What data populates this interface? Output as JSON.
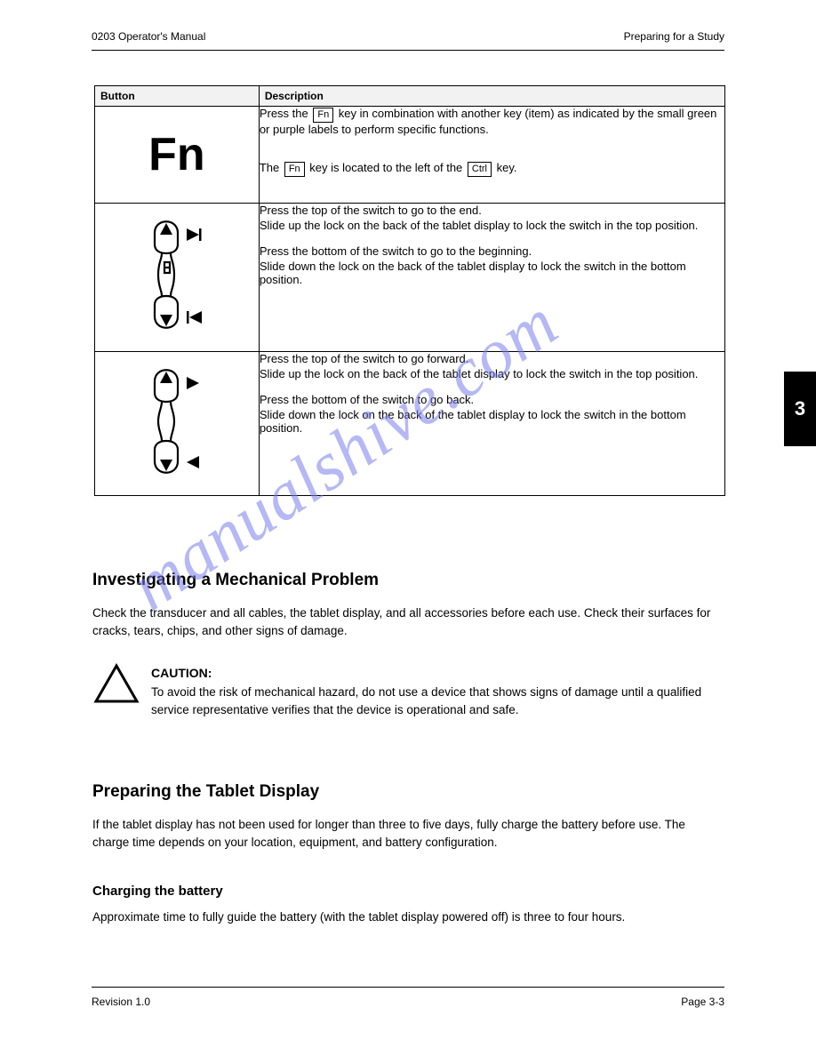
{
  "header": {
    "left": "0203 Operator's Manual",
    "right": "Preparing for a Study"
  },
  "table": {
    "th_button": "Button",
    "th_desc": "Description",
    "row1_text1": "Press the ",
    "row1_key1": "Fn",
    "row1_text2": " key in combination with another key (item) as indicated by the small green or purple labels to perform specific functions.",
    "row1_text3": "The ",
    "row1_key2": "Fn",
    "row1_text4": " key is located to the left of the ",
    "row1_key3": "Ctrl",
    "row1_text5": " key.",
    "row2_line1": "Press the top of the switch to go to the end.",
    "row2_line2": "Slide up the lock on the back of the tablet display to lock the switch in the top position.",
    "row2_line3": "Press the bottom of the switch to go to the beginning.",
    "row2_line4": "Slide down the lock on the back of the tablet display to lock the switch in the bottom position.",
    "row3_line1": "Press the top of the switch to go forward.",
    "row3_line2": "Slide up the lock on the back of the tablet display to lock the switch in the top position.",
    "row3_line3": "Press the bottom of the switch to go back.",
    "row3_line4": "Slide down the lock on the back of the tablet display to lock the switch in the bottom position."
  },
  "sidebar": {
    "number": "3"
  },
  "sections": {
    "heading1": "Investigating a Mechanical Problem",
    "p1": "Check the transducer and all cables, the tablet display, and all accessories before each use. Check their surfaces for cracks, tears, chips, and other signs of damage.",
    "caution_label": "CAUTION:",
    "caution_body": "To avoid the risk of mechanical hazard, do not use a device that shows signs of damage until a qualified service representative verifies that the device is operational and safe.",
    "heading2": "Preparing the Tablet Display",
    "p2": "If the tablet display has not been used for longer than three to five days, fully charge the battery before use. The charge time depends on your location, equipment, and battery configuration.",
    "sub1": "Charging the battery",
    "p3": "Approximate time to fully guide the battery (with the tablet display powered off) is three to four hours."
  },
  "footer": {
    "left": "Revision 1.0",
    "right": "Page 3-3"
  },
  "watermark": "manualshive.com"
}
